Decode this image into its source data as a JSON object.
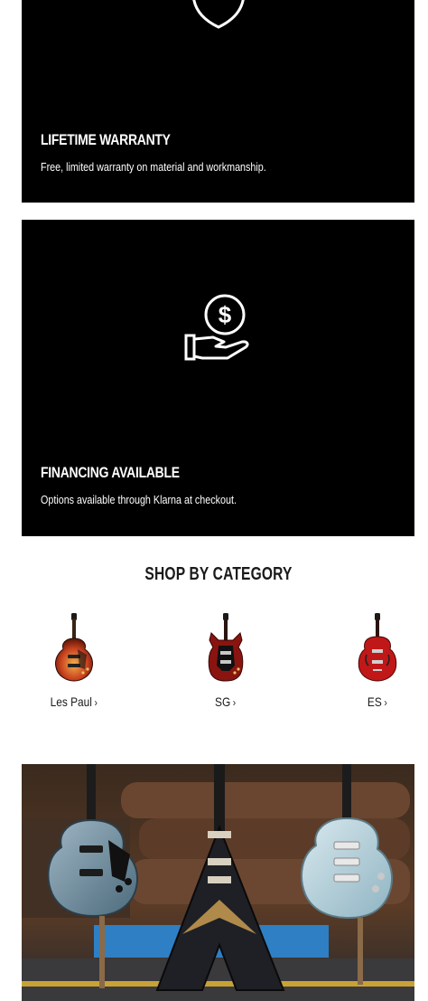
{
  "features": [
    {
      "icon": "shield-check-icon",
      "title": "LIFETIME WARRANTY",
      "description": "Free, limited warranty on material and workmanship."
    },
    {
      "icon": "hand-dollar-icon",
      "title": "FINANCING AVAILABLE",
      "description": "Options available through Klarna at checkout."
    }
  ],
  "shop_by_category": {
    "title": "SHOP BY CATEGORY",
    "items": [
      {
        "label": "Les Paul",
        "icon": "les-paul-guitar-image"
      },
      {
        "label": "SG",
        "icon": "sg-guitar-image"
      },
      {
        "label": "ES",
        "icon": "es-guitar-image"
      }
    ]
  },
  "colors": {
    "card_bg": "#000000",
    "text_dark": "#1a1a1a",
    "white": "#ffffff"
  }
}
